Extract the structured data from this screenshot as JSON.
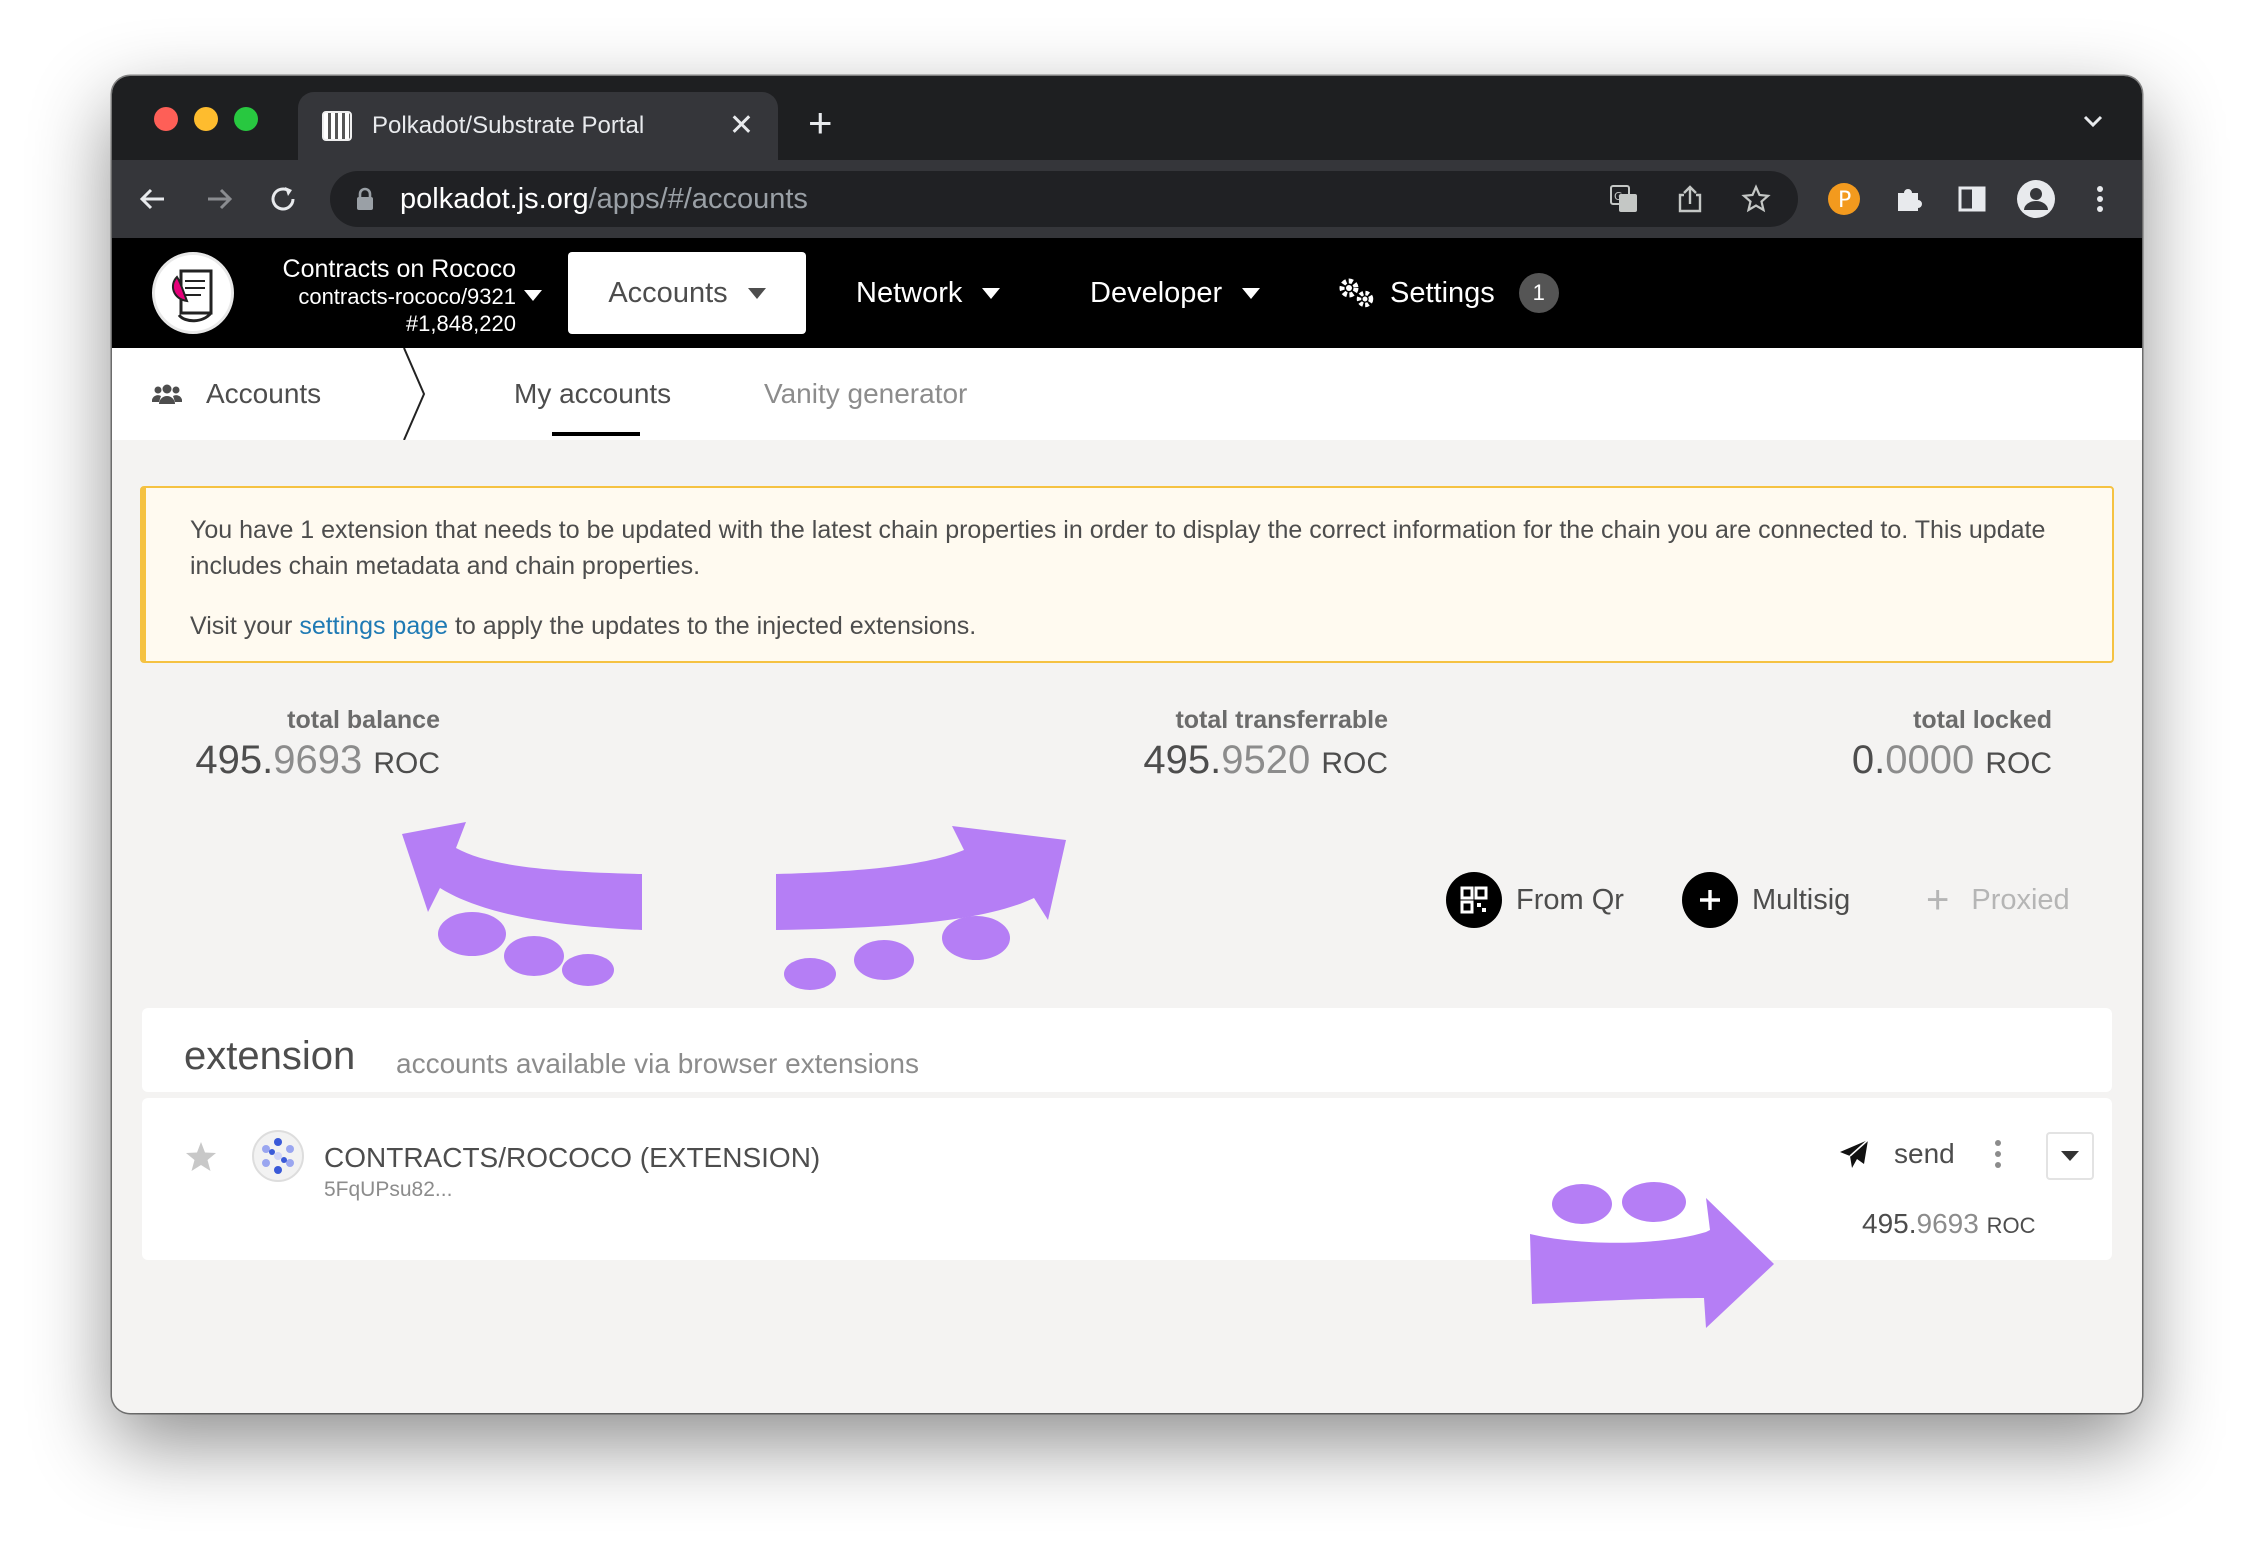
{
  "browser": {
    "tab_title": "Polkadot/Substrate Portal",
    "url_host": "polkadot.js.org",
    "url_path": "/apps/#/accounts"
  },
  "chain": {
    "name": "Contracts on Rococo",
    "id": "contracts-rococo/9321",
    "block": "#1,848,220"
  },
  "menu": {
    "accounts": "Accounts",
    "network": "Network",
    "developer": "Developer",
    "settings": "Settings",
    "settings_badge": "1"
  },
  "subnav": {
    "section": "Accounts",
    "tabs": [
      {
        "label": "My accounts",
        "active": true
      },
      {
        "label": "Vanity generator",
        "active": false
      }
    ]
  },
  "warning": {
    "line1": "You have 1 extension that needs to be updated with the latest chain properties in order to display the correct information for the chain you are connected to. This update includes chain metadata and chain properties.",
    "line2_prefix": "Visit your ",
    "line2_link": "settings page",
    "line2_suffix": " to apply the updates to the injected extensions."
  },
  "summary": {
    "balance": {
      "label": "total balance",
      "int": "495.",
      "dec": "9693",
      "unit": "ROC"
    },
    "transferrable": {
      "label": "total transferrable",
      "int": "495.",
      "dec": "9520",
      "unit": "ROC"
    },
    "locked": {
      "label": "total locked",
      "int": "0.",
      "dec": "0000",
      "unit": "ROC"
    }
  },
  "actions": {
    "from_qr": "From Qr",
    "multisig": "Multisig",
    "proxied": "Proxied"
  },
  "extension": {
    "title": "extension",
    "subtitle": "accounts available via browser extensions",
    "account": {
      "name": "CONTRACTS/ROCOCO (EXTENSION)",
      "address": "5FqUPsu82...",
      "send": "send",
      "balance_int": "495.",
      "balance_dec": "9693",
      "balance_unit": "ROC"
    }
  },
  "colors": {
    "annotation_purple": "#b57ef5",
    "warning_border": "#f5c242",
    "link": "#1f7ab4"
  }
}
